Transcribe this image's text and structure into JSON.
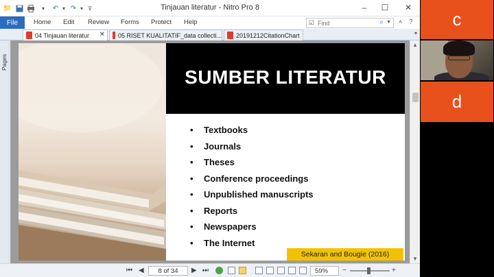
{
  "window": {
    "title": "Tinjauan literatur - Nitro Pro 8",
    "controls": {
      "minimize": "–",
      "maximize": "☐",
      "close": "✕"
    }
  },
  "quick_access_icons": [
    "folder-icon",
    "save-icon",
    "print-icon",
    "undo-icon",
    "redo-icon",
    "dropdown-icon"
  ],
  "ribbon": {
    "file_label": "File",
    "tabs": [
      "Home",
      "Edit",
      "Review",
      "Forms",
      "Protect",
      "Help"
    ],
    "find_placeholder": "Find"
  },
  "document_tabs": [
    {
      "label": "04 Tinjauan literatur",
      "active": true
    },
    {
      "label": "05 RISET KUALITATIF_data collecti...",
      "active": false
    },
    {
      "label": "20191212CitationChart",
      "active": false
    }
  ],
  "side_pane": {
    "pages_label": "Pages"
  },
  "slide": {
    "title": "SUMBER LITERATUR",
    "bullets": [
      "Textbooks",
      "Journals",
      "Theses",
      "Conference proceedings",
      "Unpublished manuscripts",
      "Reports",
      "Newspapers",
      "The Internet"
    ],
    "citation": "Sekaran and Bougie  (2016)",
    "citation_color": "#f2c200"
  },
  "status_bar": {
    "page_indicator": "8 of 34",
    "zoom": "59%",
    "zoom_minus": "−",
    "zoom_plus": "+"
  },
  "video_panel": {
    "tiles": [
      {
        "letter": "c",
        "color": "#e8501c"
      },
      {
        "letter": "d",
        "color": "#e8501c"
      }
    ]
  },
  "colors": {
    "accent": "#2b6cc0",
    "slide_title_bg": "#000000"
  }
}
